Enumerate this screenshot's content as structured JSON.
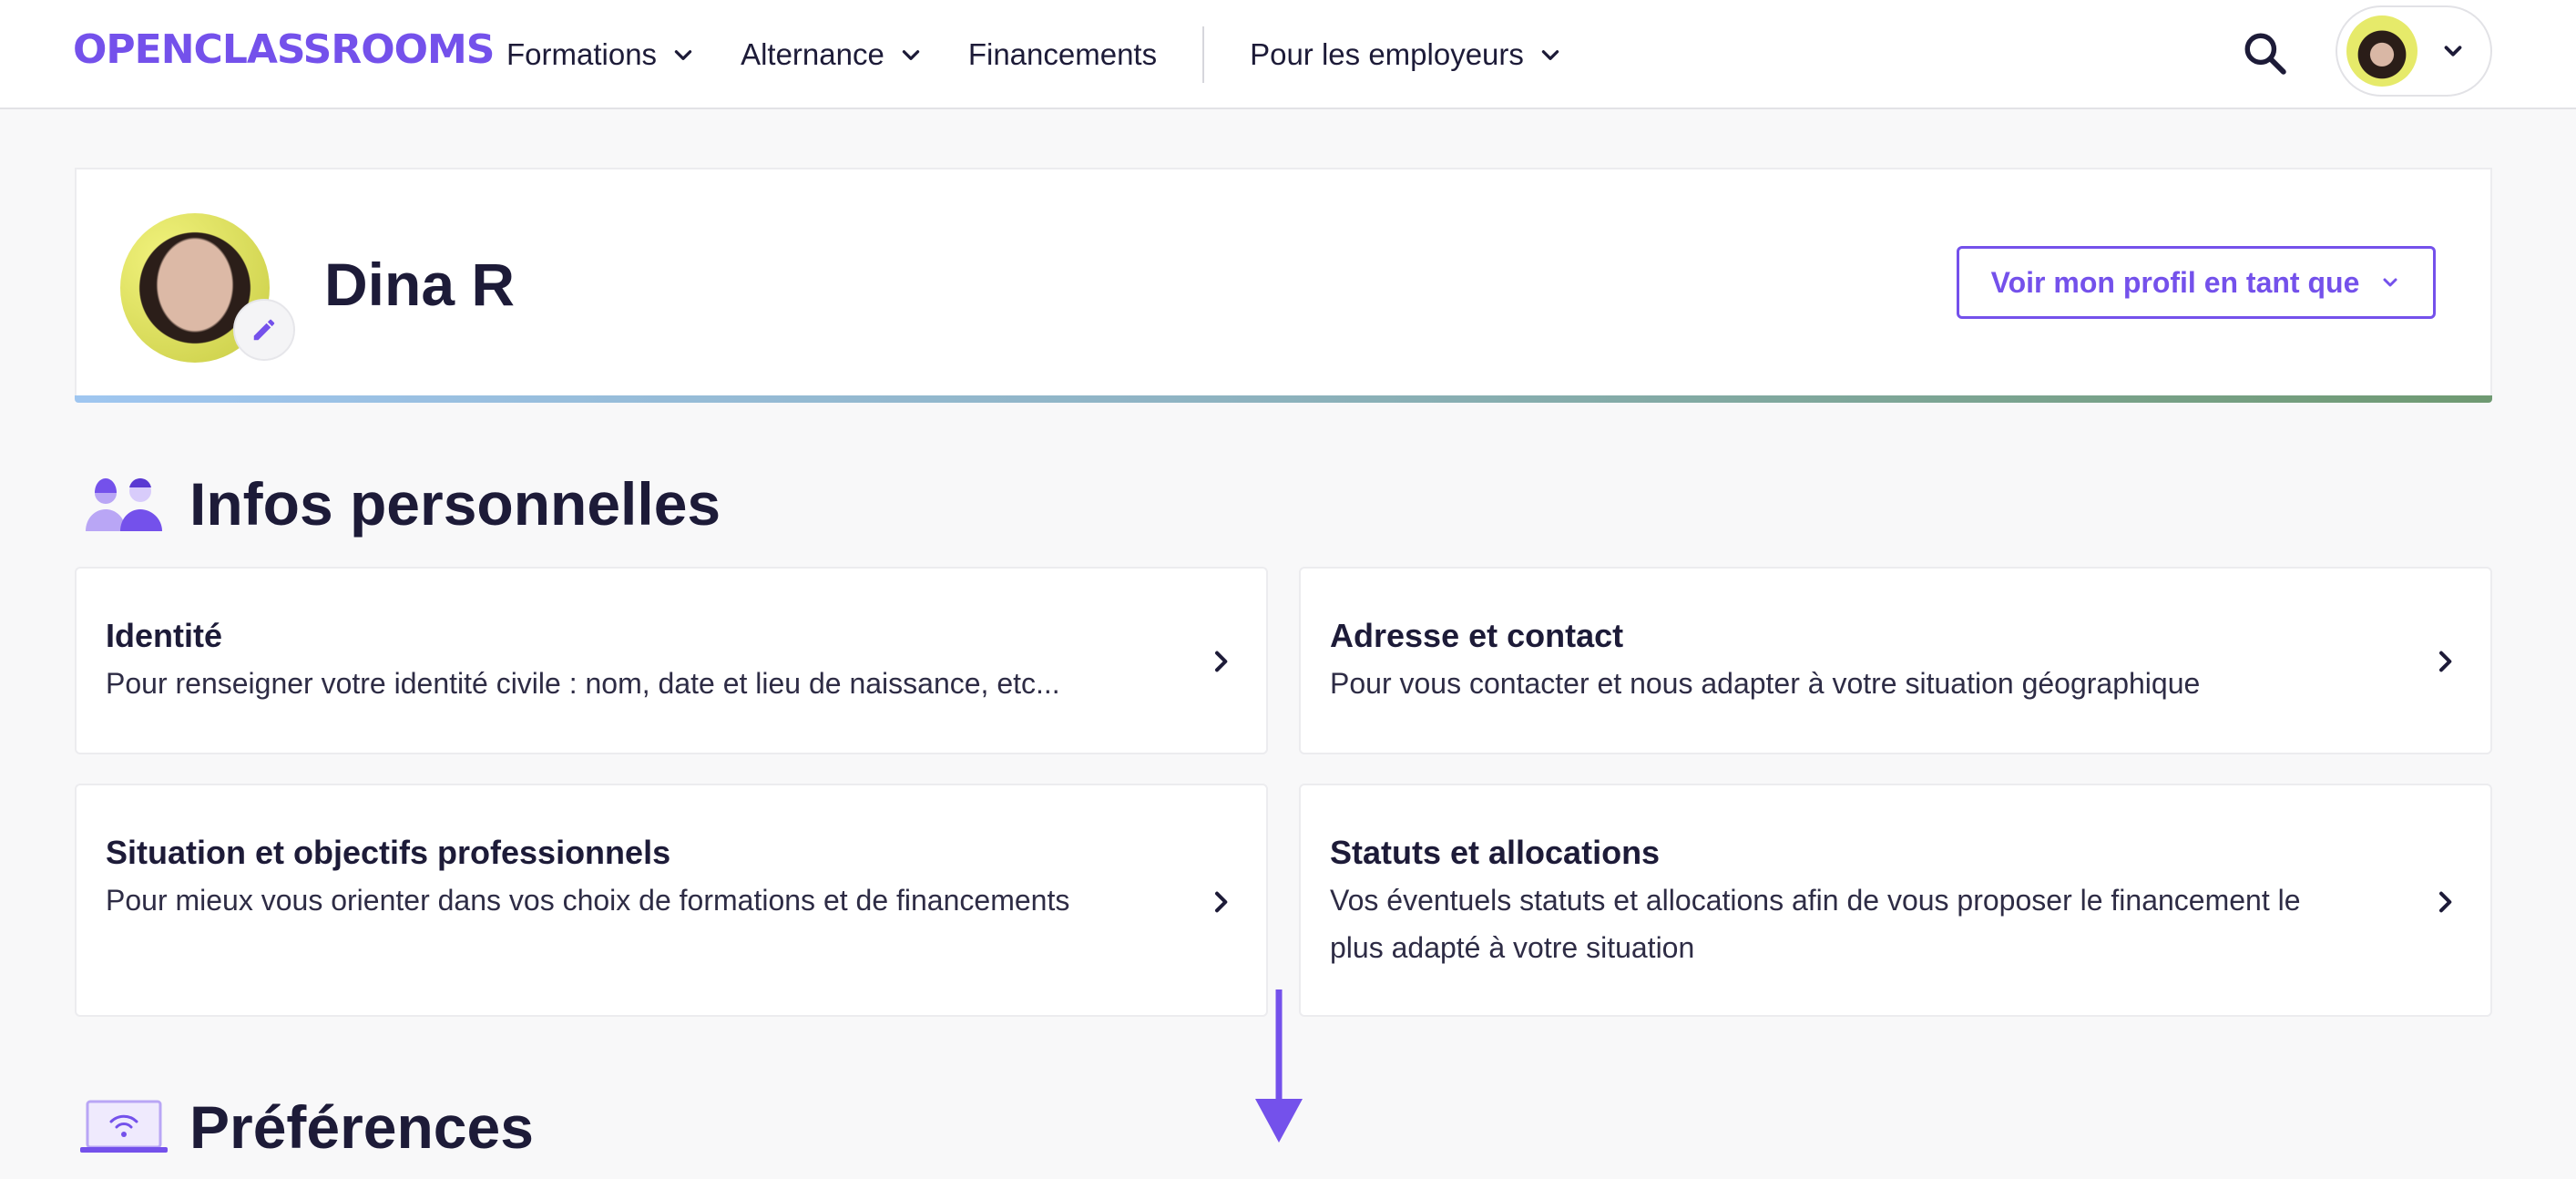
{
  "header": {
    "logo": "OPENCLASSROOMS",
    "nav": [
      {
        "label": "Formations",
        "has_menu": true
      },
      {
        "label": "Alternance",
        "has_menu": true
      },
      {
        "label": "Financements",
        "has_menu": false
      },
      {
        "label": "Pour les employeurs",
        "has_menu": true
      }
    ]
  },
  "profile": {
    "name": "Dina R",
    "view_as_label": "Voir mon profil en tant que"
  },
  "sections": {
    "personal": {
      "title": "Infos personnelles",
      "cards": [
        {
          "title": "Identité",
          "desc_lines": [
            "Pour renseigner votre identité civile : nom, date et lieu de naissance, etc..."
          ]
        },
        {
          "title": "Adresse et contact",
          "desc_lines": [
            "Pour vous contacter et nous adapter à votre situation géographique"
          ]
        },
        {
          "title": "Situation et objectifs professionnels",
          "desc_lines": [
            "Pour mieux vous orienter dans vos choix de formations et de financements"
          ]
        },
        {
          "title": "Statuts et allocations",
          "desc_lines": [
            "Vos éventuels statuts et allocations afin de vous proposer le financement le",
            "plus adapté à votre situation"
          ]
        }
      ]
    },
    "preferences": {
      "title": "Préférences"
    }
  },
  "colors": {
    "accent": "#7451eb",
    "text": "#1d1b38",
    "background": "#f8f8f9"
  }
}
